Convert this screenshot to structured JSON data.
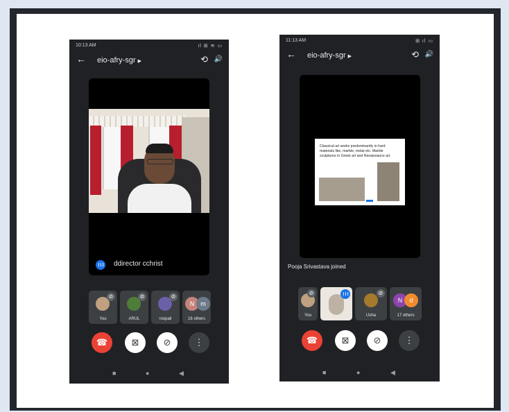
{
  "phones": [
    {
      "status_time": "10:13 AM",
      "status_right": "ıl ⊞ ≋ ▭",
      "meeting_title": "eio-afry-sgr",
      "speaker_name": "ddirector cchrist",
      "tiles": [
        {
          "label": "You",
          "avatar": "",
          "color": "#c0a080"
        },
        {
          "label": "ARUL",
          "avatar": "",
          "color": "#4e7d3a"
        },
        {
          "label": "roopali",
          "avatar": "",
          "color": "#6b5fa8"
        },
        {
          "label": "16 others",
          "avatar": "N",
          "avatar2": "m",
          "color": "#c5847a",
          "color2": "#6d7a89"
        }
      ]
    },
    {
      "status_time": "11:13 AM",
      "status_right": "⊞ ıl ▭",
      "meeting_title": "eio-afry-sgr",
      "slide_text": "Classical art works predominantly in hard materials like, marble, metal etc. Marble sculptures in Greek art and Renaissance art.",
      "joined_text": "Pooja Srivastava joined",
      "tiles": [
        {
          "label": "You",
          "avatar": "",
          "color": "#c0a080"
        },
        {
          "label": "",
          "avatar": "",
          "color": "#e6e1d9"
        },
        {
          "label": "Usha",
          "avatar": "",
          "color": "#a57a2d"
        },
        {
          "label": "17 others",
          "avatar": "N",
          "avatar2": "d",
          "color": "#8e44ad",
          "color2": "#f28b30"
        }
      ]
    }
  ],
  "colors": {
    "end_call": "#ea4335",
    "accent": "#1a73e8",
    "phone_bg": "#202124"
  },
  "icons": [
    "back-arrow-icon",
    "camera-switch-icon",
    "speaker-icon",
    "end-call-icon",
    "camera-off-icon",
    "mic-off-icon",
    "more-vert-icon"
  ]
}
